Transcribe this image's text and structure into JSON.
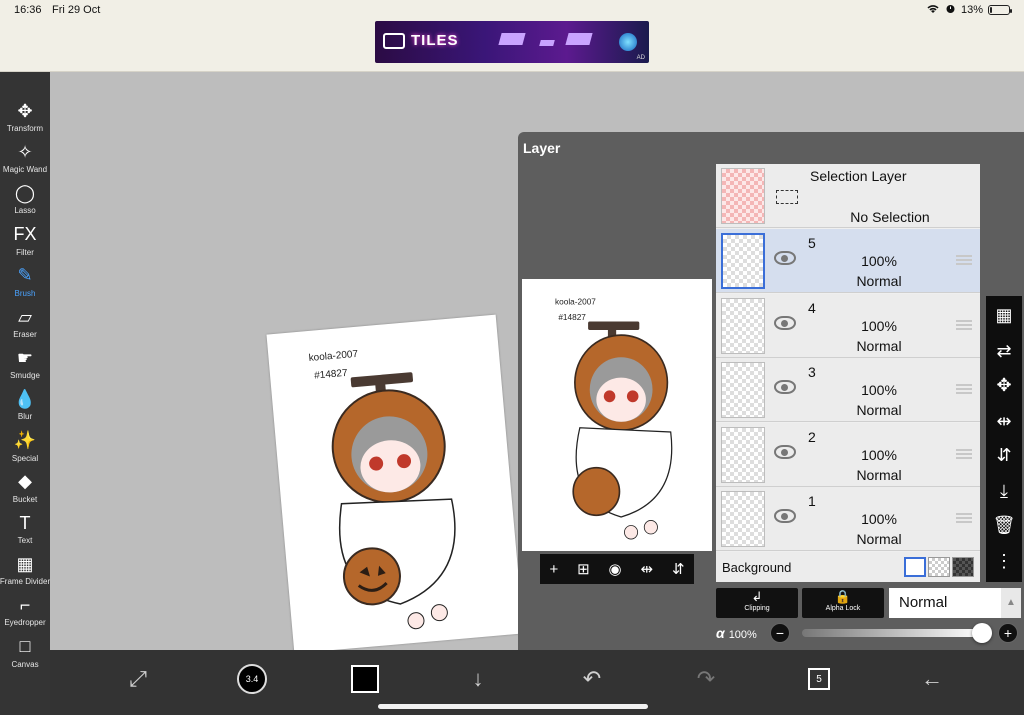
{
  "status": {
    "time": "16:36",
    "date": "Fri 29 Oct",
    "battery": "13%",
    "battery_level": 0.13
  },
  "ad": {
    "title": "TILES",
    "badge": "AD"
  },
  "toolbar": {
    "tools": [
      {
        "label": "Transform",
        "icon": "✥"
      },
      {
        "label": "Magic Wand",
        "icon": "✧"
      },
      {
        "label": "Lasso",
        "icon": "◯"
      },
      {
        "label": "Filter",
        "icon": "FX"
      },
      {
        "label": "Brush",
        "icon": "✎"
      },
      {
        "label": "Eraser",
        "icon": "▱"
      },
      {
        "label": "Smudge",
        "icon": "☛"
      },
      {
        "label": "Blur",
        "icon": "💧"
      },
      {
        "label": "Special",
        "icon": "✨"
      },
      {
        "label": "Bucket",
        "icon": "◆"
      },
      {
        "label": "Text",
        "icon": "T"
      },
      {
        "label": "Frame Divider",
        "icon": "▦"
      },
      {
        "label": "Eyedropper",
        "icon": "⌐"
      },
      {
        "label": "Canvas",
        "icon": "□"
      }
    ],
    "active_tool": "Brush",
    "accent_color": "#4aa3ff"
  },
  "canvas": {
    "signature_line1": "koola-2007",
    "signature_line2": "#14827"
  },
  "layer_panel": {
    "title": "Layer",
    "selection_layer": {
      "title": "Selection Layer",
      "status": "No Selection"
    },
    "layers": [
      {
        "name": "5",
        "opacity": "100%",
        "mode": "Normal",
        "selected": true
      },
      {
        "name": "4",
        "opacity": "100%",
        "mode": "Normal",
        "selected": false
      },
      {
        "name": "3",
        "opacity": "100%",
        "mode": "Normal",
        "selected": false
      },
      {
        "name": "2",
        "opacity": "100%",
        "mode": "Normal",
        "selected": false
      },
      {
        "name": "1",
        "opacity": "100%",
        "mode": "Normal",
        "selected": false
      }
    ],
    "background_label": "Background",
    "clipping_label": "Clipping",
    "alpha_lock_label": "Alpha Lock",
    "blend_mode": "Normal",
    "alpha_symbol": "α",
    "alpha_value": "100%",
    "alpha_fraction": 1.0,
    "selection_color": "#d5deee"
  },
  "bottom_bar": {
    "brush_size": "3.4",
    "pages": "5",
    "primary_color": "#000000"
  }
}
